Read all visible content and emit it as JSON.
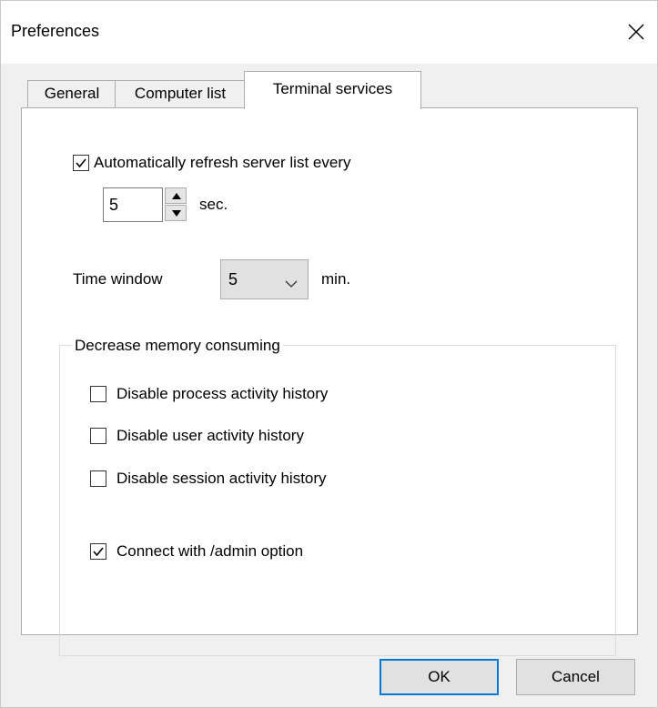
{
  "window": {
    "title": "Preferences"
  },
  "tabs": [
    {
      "label": "General"
    },
    {
      "label": "Computer list"
    },
    {
      "label": "Terminal services"
    }
  ],
  "refresh": {
    "label": "Automatically refresh server list every",
    "checked": true,
    "interval_value": "5",
    "unit": "sec."
  },
  "time_window": {
    "label": "Time window",
    "selected": "5",
    "unit": "min."
  },
  "memory_group": {
    "title": "Decrease memory consuming",
    "options": [
      {
        "label": "Disable process activity history",
        "checked": false
      },
      {
        "label": "Disable user activity history",
        "checked": false
      },
      {
        "label": "Disable session activity history",
        "checked": false
      }
    ]
  },
  "admin": {
    "label": "Connect with /admin option",
    "checked": true
  },
  "buttons": {
    "ok": "OK",
    "cancel": "Cancel"
  }
}
